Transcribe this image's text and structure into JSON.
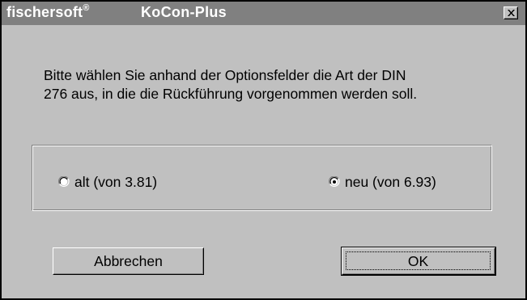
{
  "window": {
    "brand": "fischersoft",
    "brand_mark": "®",
    "title": "KoCon-Plus",
    "close_icon": "close-x-icon"
  },
  "message": {
    "line1": "Bitte wählen Sie anhand der Optionsfelder die Art der DIN",
    "line2": "276 aus, in die die Rückführung vorgenommen werden soll."
  },
  "options": {
    "alt": {
      "label": "alt (von 3.81)",
      "selected": false
    },
    "neu": {
      "label": "neu (von 6.93)",
      "selected": true
    }
  },
  "buttons": {
    "cancel": "Abbrechen",
    "ok": "OK"
  },
  "colors": {
    "titlebar": "#808080",
    "face": "#c0c0c0",
    "text": "#000000"
  }
}
